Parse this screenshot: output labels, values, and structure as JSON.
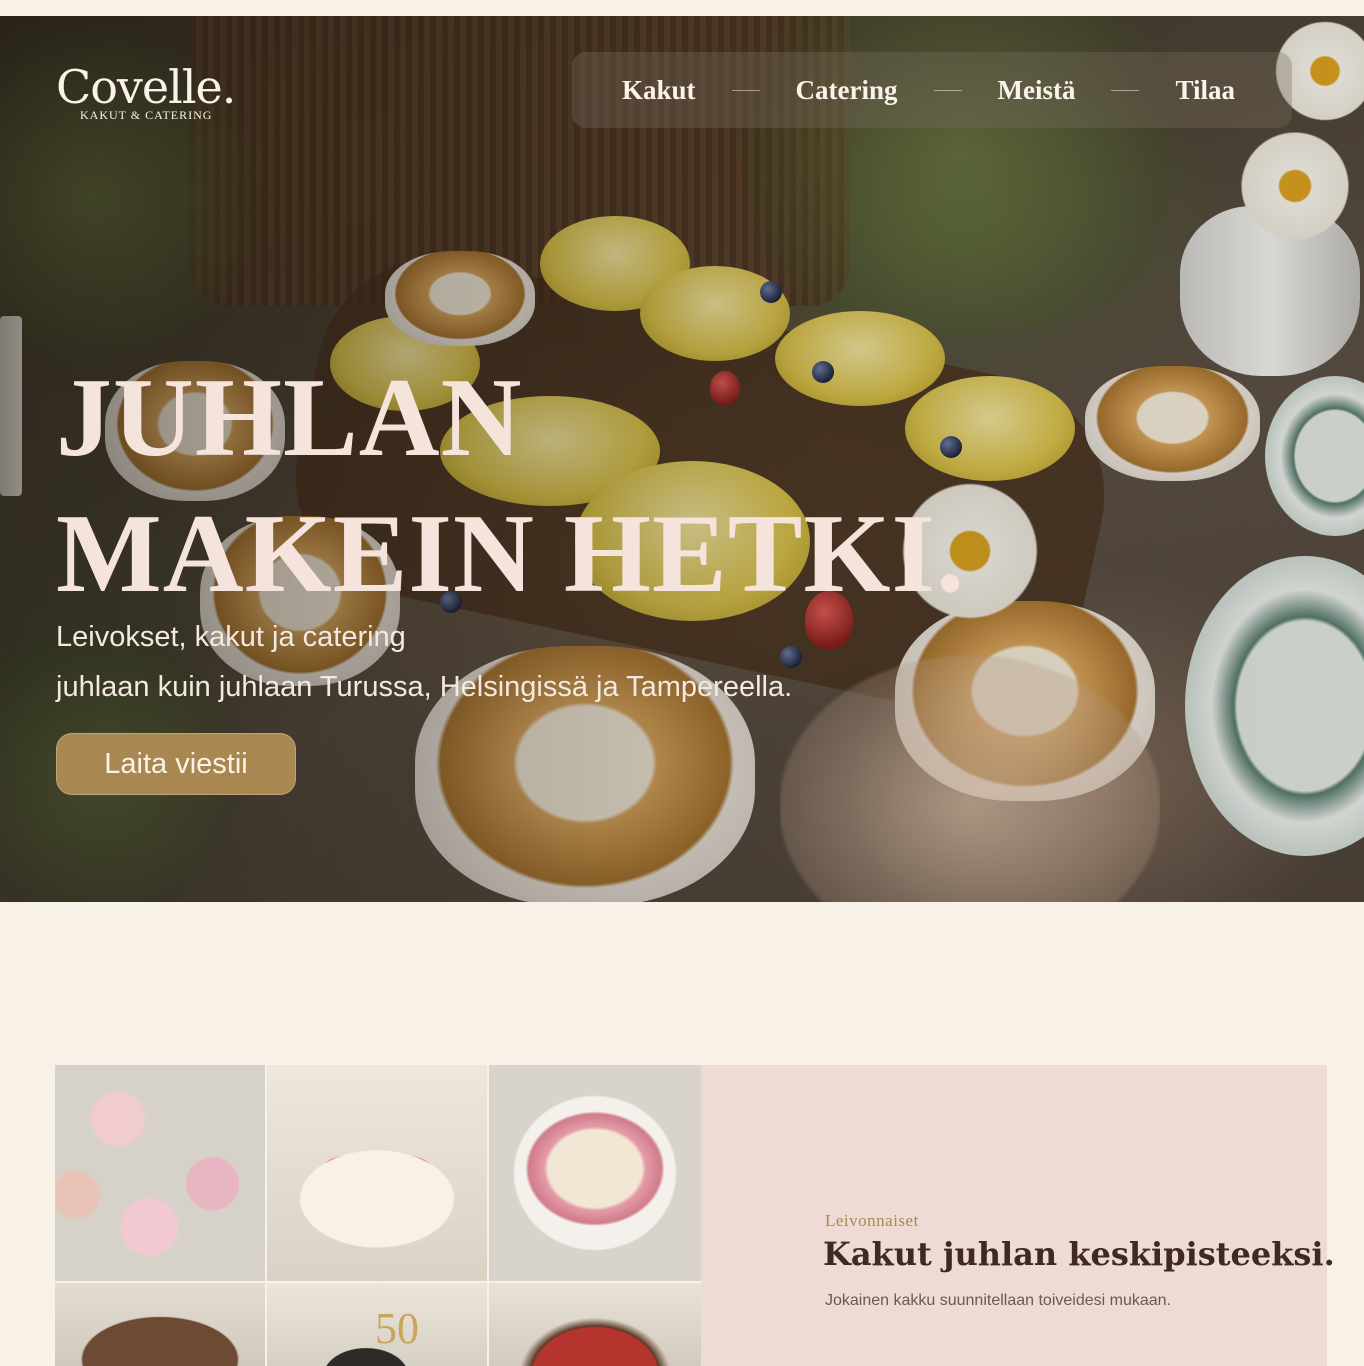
{
  "brand": {
    "name": "Covelle.",
    "tagline": "KAKUT & CATERING"
  },
  "nav": {
    "items": [
      {
        "label": "Kakut"
      },
      {
        "label": "Catering"
      },
      {
        "label": "Meistä"
      },
      {
        "label": "Tilaa"
      }
    ]
  },
  "hero": {
    "title_line1": "JUHLAN",
    "title_line2": "MAKEIN HETKI.",
    "subtitle_line1": "Leivokset, kakut ja catering",
    "subtitle_line2": "juhlaan kuin juhlaan Turussa, Helsingissä ja Tampereella.",
    "cta_label": "Laita viestii"
  },
  "cakes_section": {
    "eyebrow": "Leivonnaiset",
    "title": "Kakut juhlan keskipisteeksi.",
    "text": "Jokainen kakku suunnitellaan toiveidesi mukaan.",
    "gallery_topper": "50"
  },
  "colors": {
    "background": "#f7f1e8",
    "accent_gold": "#a88750",
    "panel_pink": "#efdbd5",
    "title_dark": "#3e2a22"
  }
}
